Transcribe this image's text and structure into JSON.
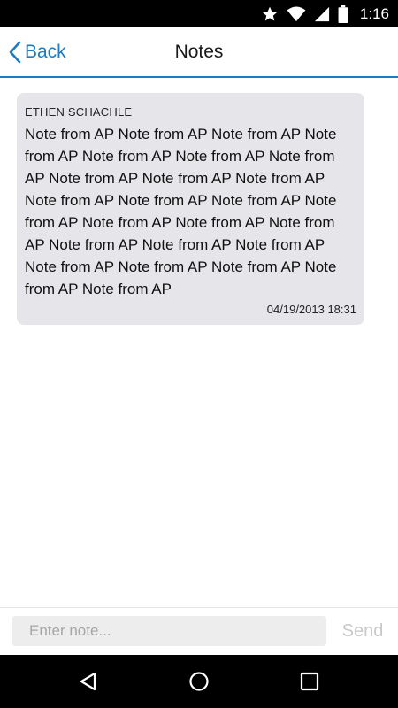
{
  "status_bar": {
    "time": "1:16",
    "icons": [
      "star-icon",
      "wifi-icon",
      "signal-icon",
      "battery-icon"
    ]
  },
  "header": {
    "back_label": "Back",
    "title": "Notes"
  },
  "notes": [
    {
      "author": "ETHEN SCHACHLE",
      "text": "Note from AP Note from AP Note from AP Note from AP Note from AP Note from AP Note from AP Note from AP Note from AP Note from AP Note from AP Note from AP Note from AP Note from AP Note from AP Note from AP Note from AP Note from AP Note from AP Note from AP Note from AP Note from AP Note from AP Note from AP Note from AP",
      "timestamp": "04/19/2013 18:31"
    }
  ],
  "composer": {
    "placeholder": "Enter note...",
    "value": "",
    "send_label": "Send"
  },
  "nav_bar": {
    "icons": [
      "back-triangle-icon",
      "home-circle-icon",
      "recents-square-icon"
    ]
  },
  "colors": {
    "accent": "#1f7ac0",
    "bubble": "#e5e5ea",
    "send_disabled": "#c9c9c9"
  }
}
